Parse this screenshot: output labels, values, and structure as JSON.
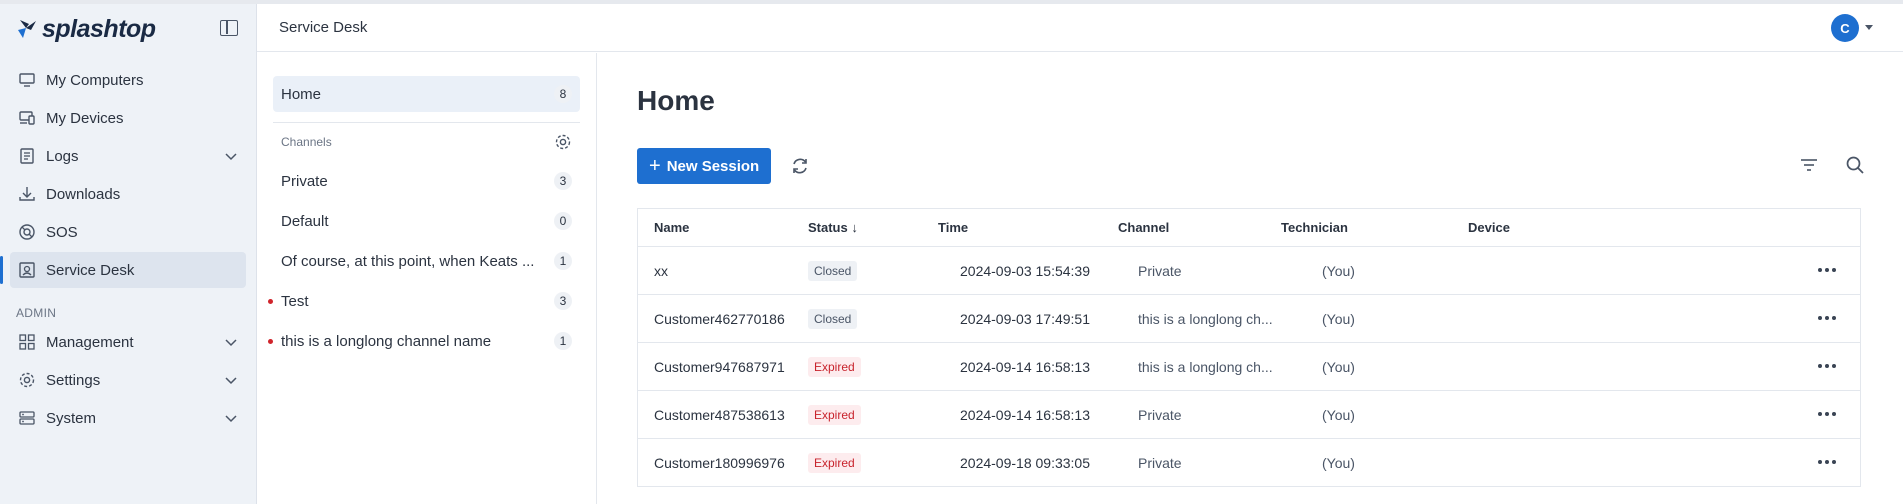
{
  "brand": {
    "name": "splashtop"
  },
  "sidebar": {
    "items": [
      {
        "label": "My Computers",
        "icon": "monitor-icon"
      },
      {
        "label": "My Devices",
        "icon": "devices-icon"
      },
      {
        "label": "Logs",
        "icon": "logs-icon",
        "expandable": true
      },
      {
        "label": "Downloads",
        "icon": "download-icon"
      },
      {
        "label": "SOS",
        "icon": "sos-icon"
      },
      {
        "label": "Service Desk",
        "icon": "service-desk-icon",
        "active": true
      }
    ],
    "admin_label": "ADMIN",
    "admin_items": [
      {
        "label": "Management",
        "icon": "grid-icon",
        "expandable": true
      },
      {
        "label": "Settings",
        "icon": "gear-icon",
        "expandable": true
      },
      {
        "label": "System",
        "icon": "server-icon",
        "expandable": true
      }
    ]
  },
  "header": {
    "title": "Service Desk",
    "avatar_initial": "C"
  },
  "channels": {
    "home": {
      "label": "Home",
      "count": "8"
    },
    "section_label": "Channels",
    "items": [
      {
        "label": "Private",
        "count": "3",
        "dot": false
      },
      {
        "label": "Default",
        "count": "0",
        "dot": false
      },
      {
        "label": "Of course, at this point, when Keats ...",
        "count": "1",
        "dot": false
      },
      {
        "label": "Test",
        "count": "3",
        "dot": true
      },
      {
        "label": "this is a longlong channel name",
        "count": "1",
        "dot": true
      }
    ]
  },
  "main": {
    "title": "Home",
    "new_session_label": "New Session",
    "table": {
      "headers": {
        "name": "Name",
        "status": "Status ↓",
        "time": "Time",
        "channel": "Channel",
        "technician": "Technician",
        "device": "Device"
      },
      "rows": [
        {
          "name": "xx",
          "status": "Closed",
          "time": "2024-09-03 15:54:39",
          "channel": "Private",
          "technician": "(You)",
          "device": ""
        },
        {
          "name": "Customer462770186",
          "status": "Closed",
          "time": "2024-09-03 17:49:51",
          "channel": "this is a longlong ch...",
          "technician": "(You)",
          "device": ""
        },
        {
          "name": "Customer947687971",
          "status": "Expired",
          "time": "2024-09-14 16:58:13",
          "channel": "this is a longlong ch...",
          "technician": "(You)",
          "device": ""
        },
        {
          "name": "Customer487538613",
          "status": "Expired",
          "time": "2024-09-14 16:58:13",
          "channel": "Private",
          "technician": "(You)",
          "device": ""
        },
        {
          "name": "Customer180996976",
          "status": "Expired",
          "time": "2024-09-18 09:33:05",
          "channel": "Private",
          "technician": "(You)",
          "device": ""
        }
      ]
    }
  },
  "colors": {
    "accent": "#1e6fd0",
    "expired": "#c8232c",
    "sidebar_bg": "#eef2f7"
  }
}
